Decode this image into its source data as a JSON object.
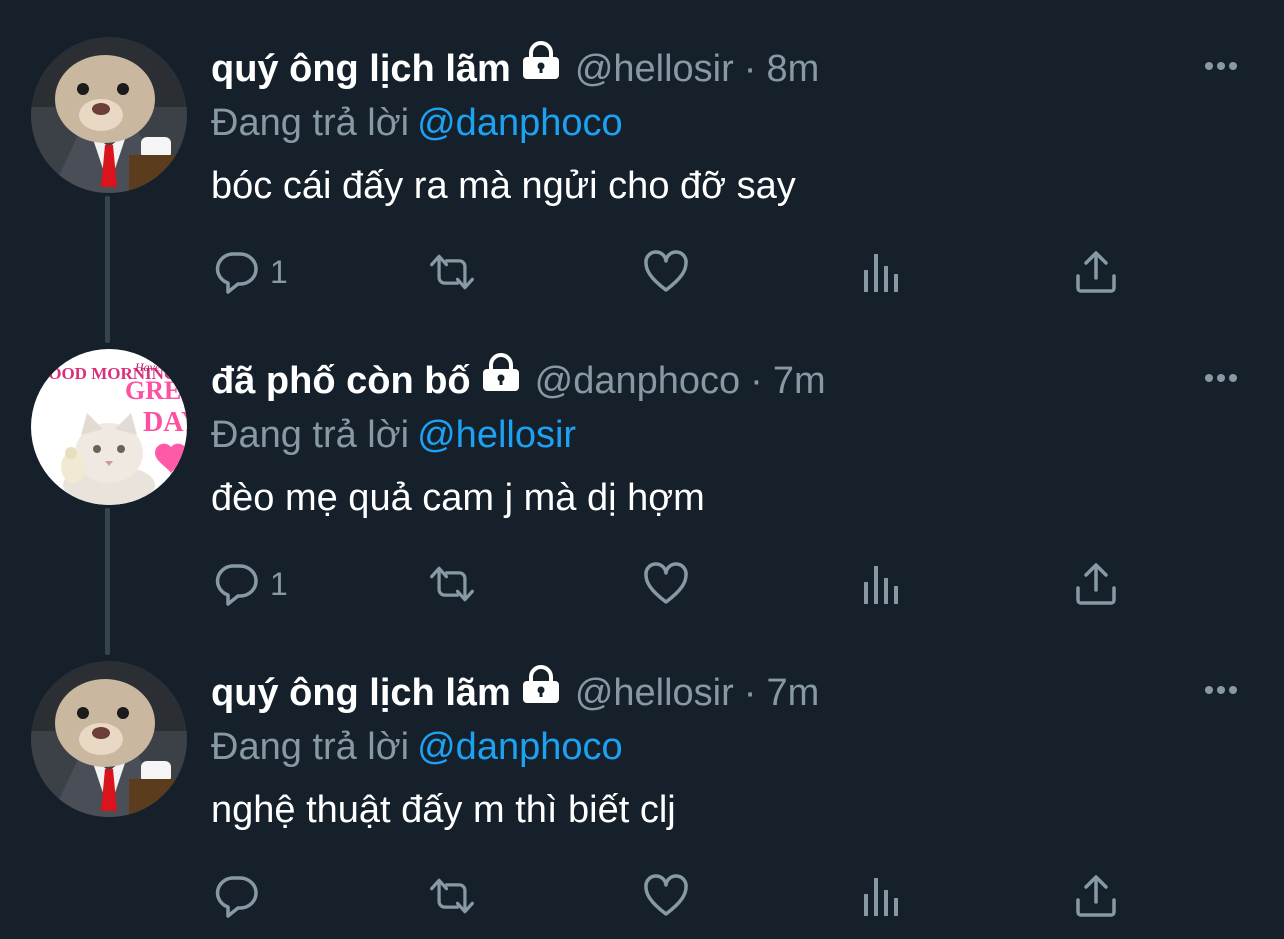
{
  "tweets": [
    {
      "display_name": "quý ông lịch lãm",
      "handle": "@hellosir",
      "separator": "·",
      "time": "8m",
      "replying_label": "Đang trả lời",
      "replying_to": "@danphoco",
      "text": "bóc cái đấy ra mà ngửi cho đỡ say",
      "reply_count": "1",
      "avatar": "hamster-in-suit"
    },
    {
      "display_name": "đã phố còn bố",
      "handle": "@danphoco",
      "separator": "·",
      "time": "7m",
      "replying_label": "Đang trả lời",
      "replying_to": "@hellosir",
      "text": "đèo mẹ quả cam j mà dị hợm",
      "reply_count": "1",
      "avatar": "good-morning-cat",
      "avatar_text": {
        "line1": "GOOD MORNING",
        "line2": "Have a",
        "line3": "GREAT",
        "line4": "DAY"
      }
    },
    {
      "display_name": "quý ông lịch lãm",
      "handle": "@hellosir",
      "separator": "·",
      "time": "7m",
      "replying_label": "Đang trả lời",
      "replying_to": "@danphoco",
      "text": "nghệ thuật đấy m thì biết clj",
      "reply_count": "",
      "avatar": "hamster-in-suit"
    }
  ],
  "icons": {
    "reply": "reply-icon",
    "retweet": "retweet-icon",
    "like": "heart-icon",
    "analytics": "analytics-icon",
    "share": "share-icon",
    "more": "more-icon",
    "protected": "lock-icon"
  },
  "colors": {
    "background": "#15202b",
    "text": "#ffffff",
    "secondary": "#8899a6",
    "link": "#1da1f2",
    "thread_line": "#38444d"
  }
}
